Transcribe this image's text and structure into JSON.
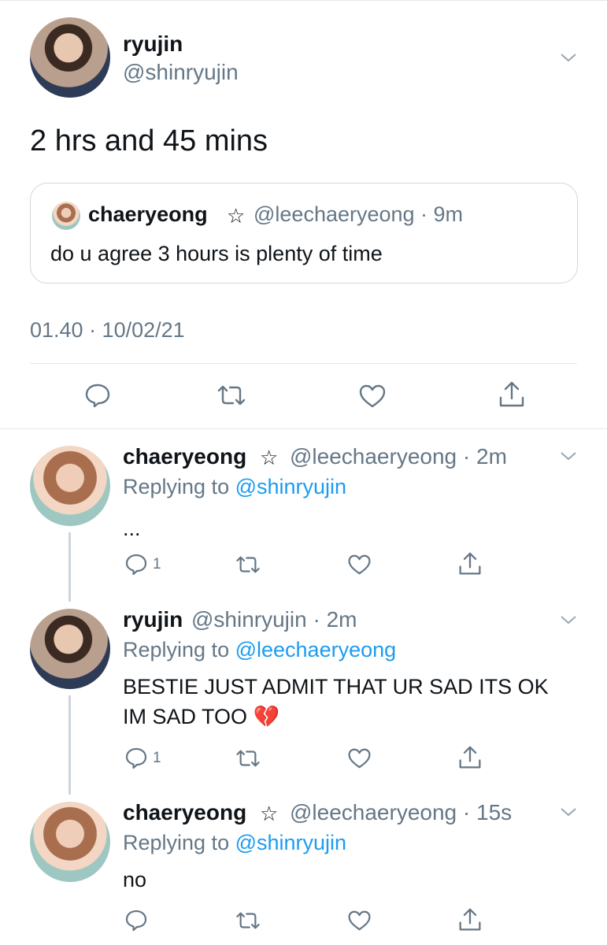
{
  "main_tweet": {
    "display_name": "ryujin",
    "handle": "@shinryujin",
    "text": "2 hrs and 45 mins",
    "timestamp": "01.40 · 10/02/21",
    "quoted": {
      "display_name": "chaeryeong",
      "badge": "☆",
      "meta": "@leechaeryeong · 9m",
      "text": "do u agree 3 hours is plenty of time"
    }
  },
  "replies": [
    {
      "display_name": "chaeryeong",
      "badge": "☆",
      "meta": "@leechaeryeong · 2m",
      "replying_prefix": "Replying to ",
      "replying_to": "@shinryujin",
      "text_lines": [
        "..."
      ],
      "reply_count": "1"
    },
    {
      "display_name": "ryujin",
      "meta": "@shinryujin · 2m",
      "replying_prefix": "Replying to ",
      "replying_to": "@leechaeryeong",
      "text_lines": [
        "BESTIE JUST ADMIT THAT UR SAD ITS OK",
        "IM SAD TOO 💔"
      ],
      "reply_count": "1"
    },
    {
      "display_name": "chaeryeong",
      "badge": "☆",
      "meta": "@leechaeryeong · 15s",
      "replying_prefix": "Replying to ",
      "replying_to": "@shinryujin",
      "text_lines": [
        "no"
      ],
      "reply_count": ""
    }
  ],
  "colors": {
    "link": "#1d9bf0",
    "secondary_text": "#657786",
    "divider": "#e1e8ed",
    "icon": "#657786"
  },
  "icons": [
    "reply-icon",
    "retweet-icon",
    "like-icon",
    "share-icon",
    "chevron-down-icon"
  ]
}
